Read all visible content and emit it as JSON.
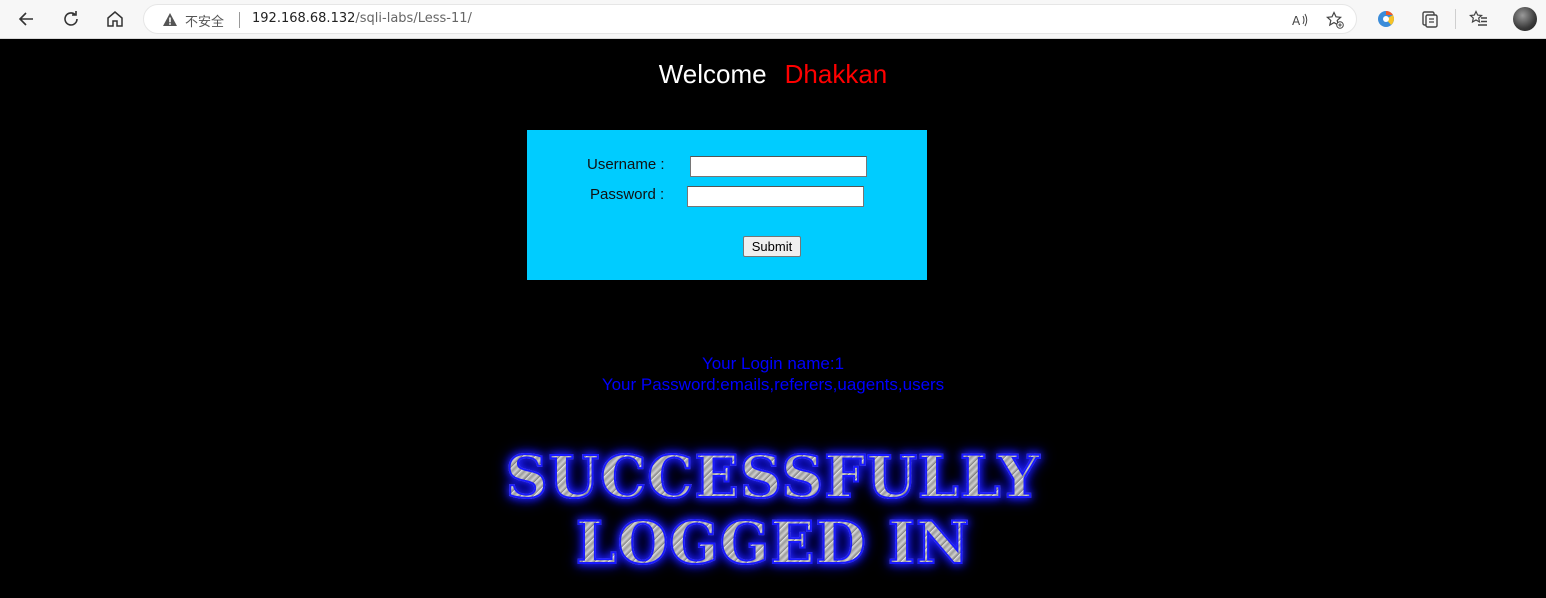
{
  "browser": {
    "security_label": "不安全",
    "url_host": "192.168.68.132",
    "url_path": "/sqli-labs/Less-11/"
  },
  "page": {
    "welcome_text": "Welcome",
    "welcome_name": "Dhakkan",
    "form": {
      "username_label": "Username :",
      "username_value": "",
      "password_label": "Password :",
      "password_value": "",
      "submit_label": "Submit"
    },
    "result": {
      "login_line": "Your Login name:1",
      "password_line": "Your Password:emails,referers,uagents,users"
    },
    "banner": {
      "line1": "SUCCESSFULLY",
      "line2": "LOGGED IN"
    }
  },
  "colors": {
    "page_bg": "#000000",
    "welcome_name": "#ff0000",
    "form_bg": "#00ccff",
    "result_text": "#0000ff"
  }
}
